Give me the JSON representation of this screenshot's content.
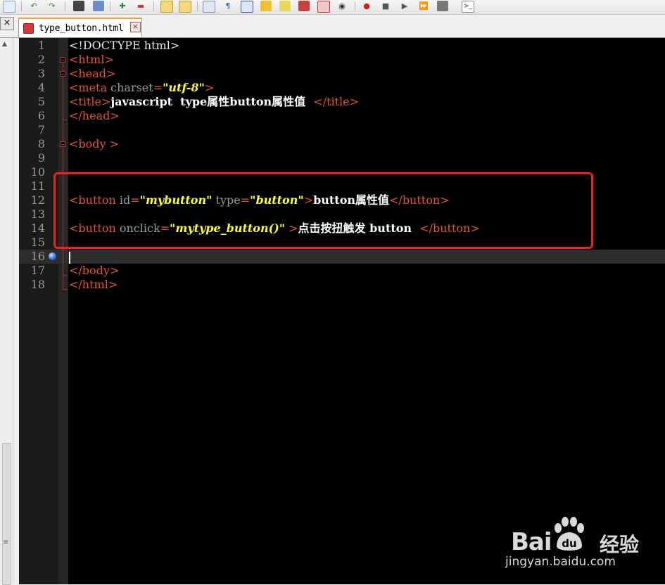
{
  "toolbar": {
    "icons": [
      "new-file-icon",
      "undo-icon",
      "redo-icon",
      "find-icon",
      "replace-icon",
      "zoom-in-icon",
      "zoom-out-icon",
      "sync-v-icon",
      "sync-h-icon",
      "word-wrap-icon",
      "show-all-chars-icon",
      "indent-guide-icon",
      "user-lang-icon",
      "doc-map-icon",
      "function-list-icon",
      "clipboard-icon",
      "monitor-icon",
      "record-macro-icon",
      "stop-record-icon",
      "play-macro-icon",
      "run-macro-multiple-icon",
      "save-macro-icon",
      "console-icon"
    ]
  },
  "panel": {
    "close_glyph": "×"
  },
  "tab": {
    "label": "type_button.html",
    "close_glyph": "×"
  },
  "editor": {
    "line_numbers": [
      "1",
      "2",
      "3",
      "4",
      "5",
      "6",
      "7",
      "8",
      "9",
      "10",
      "11",
      "12",
      "13",
      "14",
      "15",
      "16",
      "17",
      "18"
    ],
    "lines": [
      [
        {
          "c": "plain",
          "t": "<!DOCTYPE html>"
        }
      ],
      [
        {
          "c": "tag",
          "t": "<html>"
        }
      ],
      [
        {
          "c": "tag",
          "t": "<head>"
        }
      ],
      [
        {
          "c": "tag",
          "t": "<meta "
        },
        {
          "c": "attr",
          "t": "charset"
        },
        {
          "c": "tag",
          "t": "="
        },
        {
          "c": "str",
          "t": "\"utf-8\""
        },
        {
          "c": "tag",
          "t": ">"
        }
      ],
      [
        {
          "c": "tag",
          "t": "<title>"
        },
        {
          "c": "txt",
          "t": "javascript  type属性button属性值  "
        },
        {
          "c": "tag",
          "t": "</title>"
        }
      ],
      [
        {
          "c": "tag",
          "t": "</head>"
        }
      ],
      [],
      [
        {
          "c": "tag",
          "t": "<body >"
        }
      ],
      [],
      [],
      [],
      [
        {
          "c": "tag",
          "t": "<button "
        },
        {
          "c": "attr",
          "t": "id"
        },
        {
          "c": "tag",
          "t": "="
        },
        {
          "c": "str",
          "t": "\"mybutton\""
        },
        {
          "c": "tag",
          "t": " "
        },
        {
          "c": "attr",
          "t": "type"
        },
        {
          "c": "tag",
          "t": "="
        },
        {
          "c": "str",
          "t": "\"button\""
        },
        {
          "c": "tag",
          "t": ">"
        },
        {
          "c": "txt",
          "t": "button属性值"
        },
        {
          "c": "tag",
          "t": "</button>"
        }
      ],
      [],
      [
        {
          "c": "tag",
          "t": "<button "
        },
        {
          "c": "attr",
          "t": "onclick"
        },
        {
          "c": "tag",
          "t": "="
        },
        {
          "c": "str",
          "t": "\"mytype_button()\""
        },
        {
          "c": "tag",
          "t": " >"
        },
        {
          "c": "txt",
          "t": "点击按扭触发 button  "
        },
        {
          "c": "tag",
          "t": "</button>"
        }
      ],
      [],
      [],
      [
        {
          "c": "tag",
          "t": "</body>"
        }
      ],
      [
        {
          "c": "tag",
          "t": "</html>"
        }
      ]
    ],
    "current_line": 16,
    "bookmark_line": 16
  },
  "watermark": {
    "brand": "Bai",
    "paw_letters": "du",
    "product": "经验",
    "url": "jingyan.baidu.com"
  }
}
